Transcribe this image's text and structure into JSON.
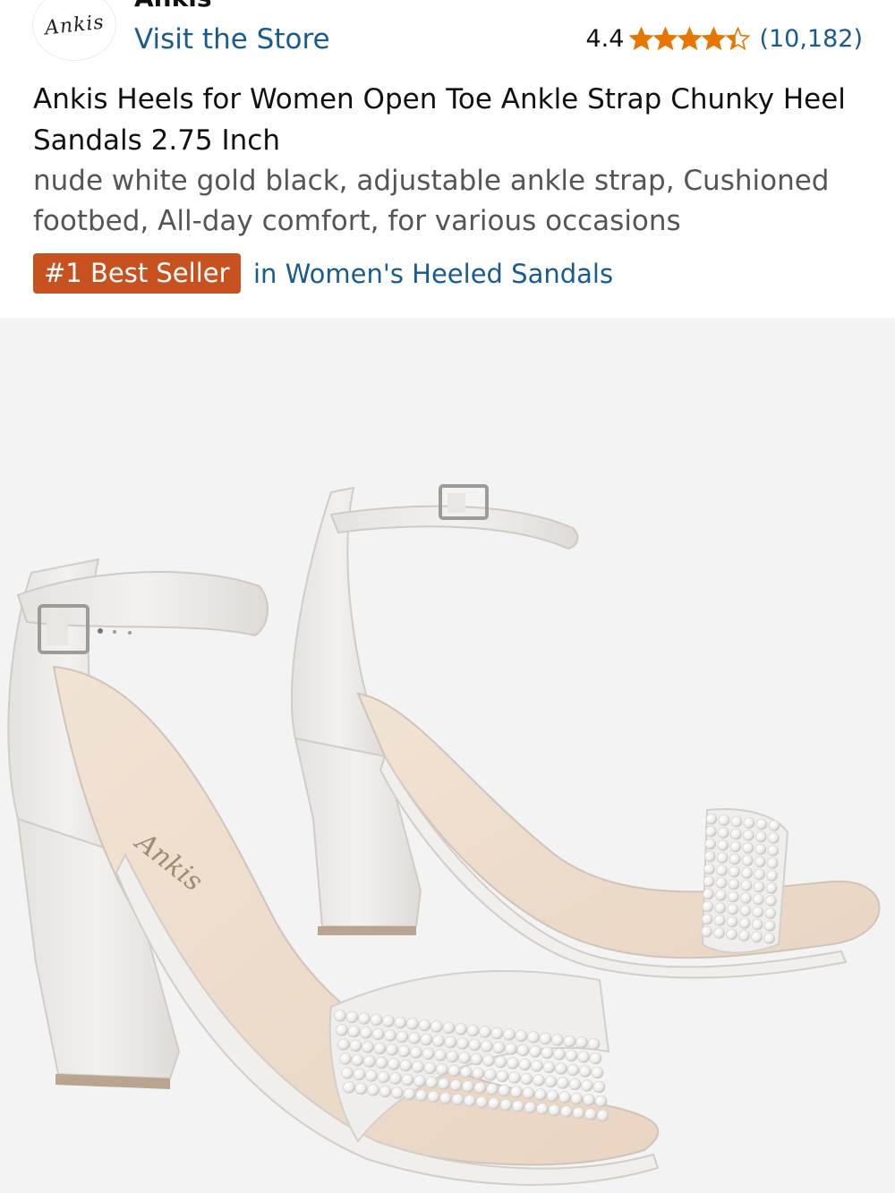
{
  "brand": {
    "logo_text": "Ankis",
    "name": "Ankis",
    "visit_store": "Visit the Store"
  },
  "rating": {
    "value": "4.4",
    "stars": 4.4,
    "review_count": "(10,182)",
    "star_color": "#e77600"
  },
  "product": {
    "title": "Ankis Heels for Women Open Toe Ankle Strap Chunky Heel Sandals 2.75 Inch",
    "subtitle": "nude white gold black, adjustable ankle strap, Cushioned footbed, All-day comfort, for various occasions"
  },
  "best_seller": {
    "badge": "#1 Best Seller",
    "category": "in Women's Heeled Sandals",
    "badge_color": "#c7511f"
  },
  "image": {
    "insole_text": "Ankis"
  },
  "colors": {
    "link": "#1a5b8f",
    "text": "#111111",
    "muted": "#555555",
    "image_bg": "#f4f3f4"
  }
}
